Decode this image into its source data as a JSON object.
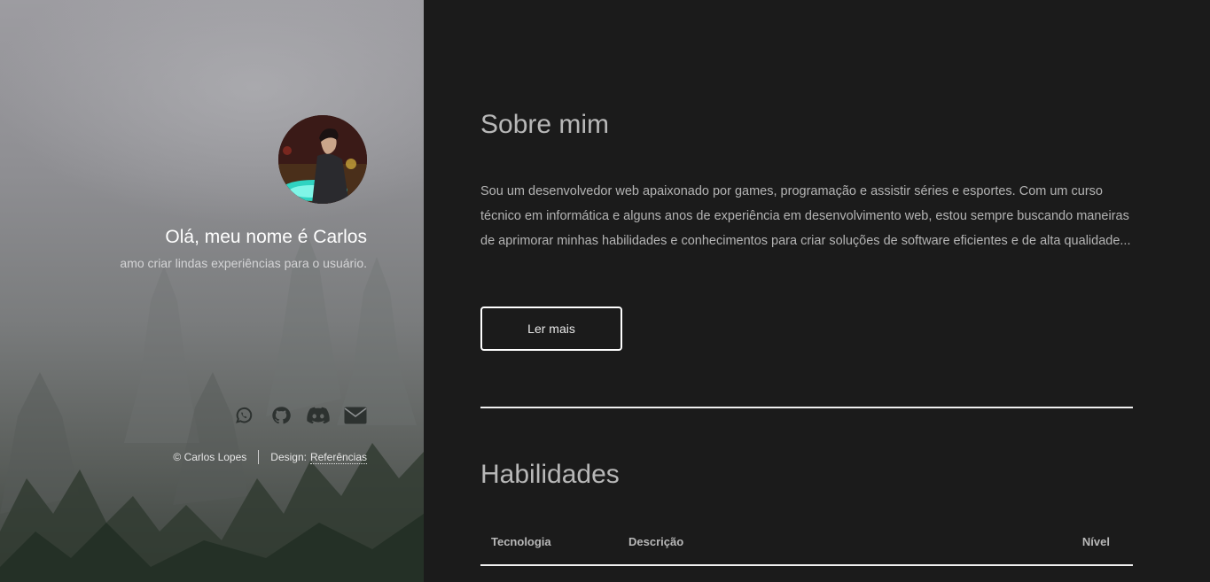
{
  "hero": {
    "title": "Olá, meu nome é Carlos",
    "subtitle": "amo criar lindas experiências para o usuário.",
    "socials": [
      {
        "icon": "whatsapp-icon"
      },
      {
        "icon": "github-icon"
      },
      {
        "icon": "discord-icon"
      },
      {
        "icon": "email-icon"
      }
    ],
    "footer": {
      "copyright": "© Carlos Lopes",
      "design_label": "Design:",
      "design_link": "Referências"
    }
  },
  "about": {
    "title": "Sobre mim",
    "text": "Sou um desenvolvedor web apaixonado por games, programação e assistir séries e esportes. Com um curso técnico em informática e alguns anos de experiência em desenvolvimento web, estou sempre buscando maneiras de aprimorar minhas habilidades e conhecimentos para criar soluções de software eficientes e de alta qualidade...",
    "button_label": "Ler mais"
  },
  "skills": {
    "title": "Habilidades",
    "columns": [
      "Tecnologia",
      "Descrição",
      "Nível"
    ]
  },
  "colors": {
    "background": "#1b1b1b",
    "text_muted": "#b4b4b4",
    "accent_white": "#ffffff"
  }
}
